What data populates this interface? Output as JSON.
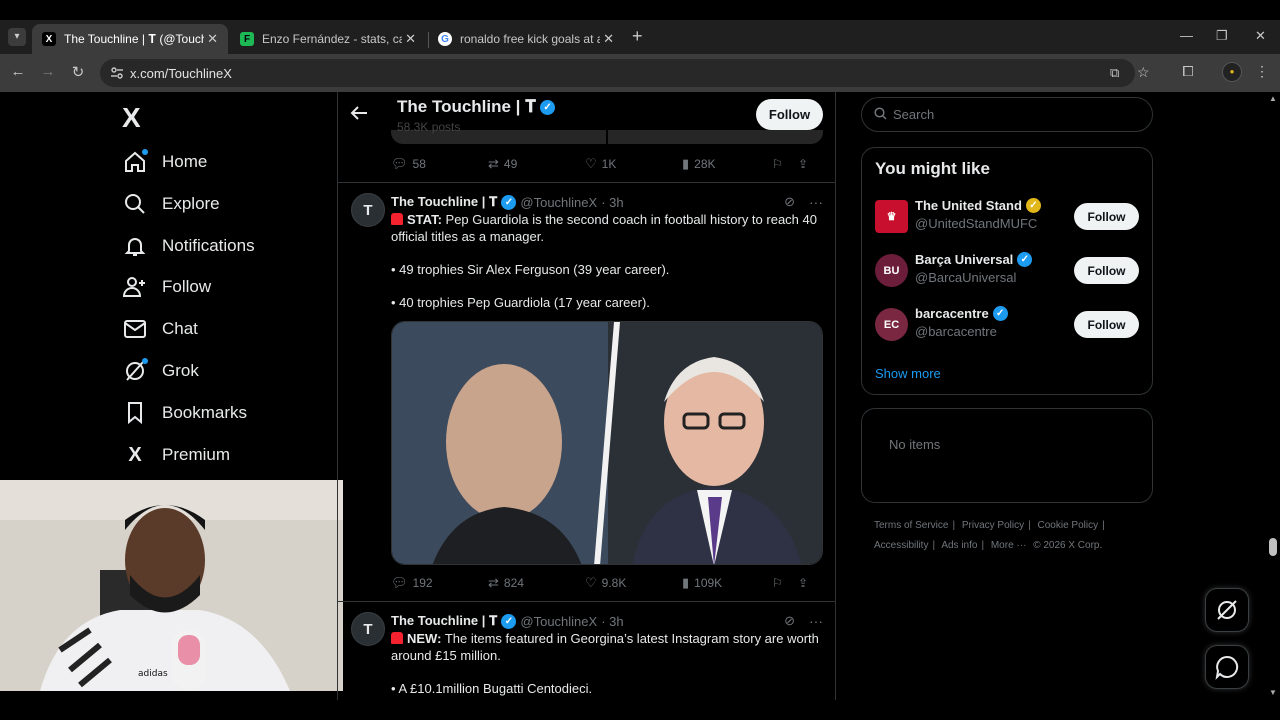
{
  "browser": {
    "tabs": [
      {
        "title": "The Touchline | 𝐓 (@TouchlineX",
        "favicon": "X",
        "active": true
      },
      {
        "title": "Enzo Fernández - stats, career a",
        "favicon": "F",
        "active": false
      },
      {
        "title": "ronaldo free kick goals at al nas",
        "favicon": "G",
        "active": false
      }
    ],
    "url": "x.com/TouchlineX"
  },
  "sidebar": {
    "logo": "X",
    "items": [
      {
        "label": "Home",
        "icon": "home-icon"
      },
      {
        "label": "Explore",
        "icon": "search-icon"
      },
      {
        "label": "Notifications",
        "icon": "bell-icon"
      },
      {
        "label": "Follow",
        "icon": "follow-icon"
      },
      {
        "label": "Chat",
        "icon": "mail-icon"
      },
      {
        "label": "Grok",
        "icon": "grok-icon"
      },
      {
        "label": "Bookmarks",
        "icon": "bookmark-icon"
      },
      {
        "label": "Premium",
        "icon": "x-icon"
      }
    ]
  },
  "profile_header": {
    "name": "The Touchline | 𝐓",
    "posts": "58.3K posts",
    "follow_label": "Follow"
  },
  "prev_tweet_actions": {
    "replies": "58",
    "reposts": "49",
    "likes": "1K",
    "views": "28K"
  },
  "tweets": [
    {
      "avatar": "T",
      "name": "The Touchline | 𝐓",
      "handle": "@TouchlineX",
      "time": "· 3h",
      "lead": "STAT:",
      "text": "Pep Guardiola is the second coach in football history to reach 40 official titles as a manager.",
      "line1": "• 49 trophies Sir Alex Ferguson (39 year career).",
      "line2": "• 40 trophies Pep Guardiola (17 year career).",
      "replies": "192",
      "reposts": "824",
      "likes": "9.8K",
      "views": "109K"
    },
    {
      "avatar": "T",
      "name": "The Touchline | 𝐓",
      "handle": "@TouchlineX",
      "time": "· 3h",
      "lead": "NEW:",
      "text": "The items featured in Georgina’s latest Instagram story are worth around £15 million.",
      "line1": "• A £10.1million Bugatti Centodieci."
    }
  ],
  "search": {
    "placeholder": "Search"
  },
  "you_might_like": {
    "title": "You might like",
    "accounts": [
      {
        "name": "The United Stand",
        "handle": "@UnitedStandMUFC",
        "badge": "gold",
        "follow": "Follow",
        "color": "#c8102e"
      },
      {
        "name": "Barça Universal",
        "handle": "@BarcaUniversal",
        "badge": "blue",
        "follow": "Follow",
        "color": "#6b1d3a"
      },
      {
        "name": "barcacentre",
        "handle": "@barcacentre",
        "badge": "blue",
        "follow": "Follow",
        "color": "#7a2842"
      }
    ],
    "show_more": "Show more"
  },
  "empty_panel": {
    "text": "No items"
  },
  "footer": {
    "links": [
      "Terms of Service",
      "Privacy Policy",
      "Cookie Policy",
      "Accessibility",
      "Ads info",
      "More ···"
    ],
    "copyright": "© 2026 X Corp."
  },
  "colors": {
    "accent": "#1d9bf0",
    "background": "#000000",
    "border": "#2f3336"
  }
}
